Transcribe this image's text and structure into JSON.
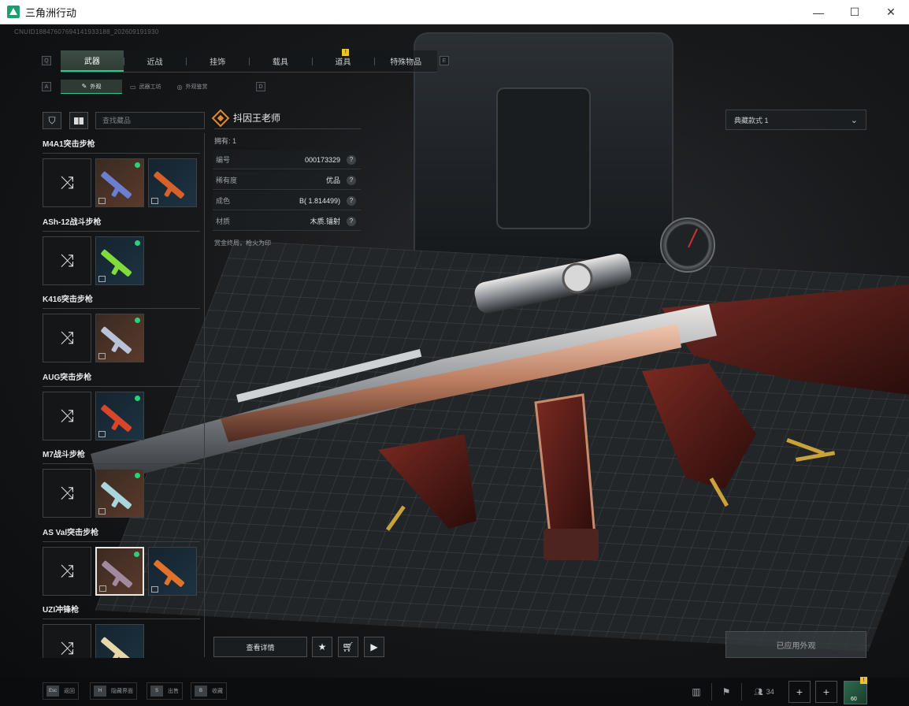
{
  "window": {
    "title": "三角洲行动",
    "controls": {
      "minimize": "—",
      "maximize": "☐",
      "close": "✕"
    }
  },
  "uid_text": "CNUID18847607694141933188_202609191930",
  "nav": {
    "left_key": "Q",
    "right_key": "E",
    "tabs": [
      {
        "label": "武器",
        "active": true
      },
      {
        "label": "近战",
        "active": false
      },
      {
        "label": "挂饰",
        "active": false
      },
      {
        "label": "载具",
        "active": false
      },
      {
        "label": "道具",
        "active": false,
        "badge": "!"
      },
      {
        "label": "特殊物品",
        "active": false
      }
    ],
    "sub_left_key": "A",
    "sub_right_key": "D",
    "subtabs": [
      {
        "label": "外观",
        "icon": "brush-icon",
        "active": true
      },
      {
        "label": "武器工坊",
        "icon": "workshop-icon",
        "active": false
      },
      {
        "label": "外观鉴赏",
        "icon": "appreciate-icon",
        "active": false
      }
    ]
  },
  "left_panel": {
    "search_placeholder": "查找藏品",
    "filter_icon": "filter-icon",
    "view_icon": "grid-view-icon",
    "groups": [
      {
        "title": "M4A1突击步枪",
        "skins": [
          {
            "type": "random"
          },
          {
            "type": "thumb",
            "owned_dot": true,
            "color": "#6a7fd0"
          },
          {
            "type": "thumb",
            "owned_dot": false,
            "color": "#d8612a",
            "tone": "blue"
          }
        ]
      },
      {
        "title": "ASh-12战斗步枪",
        "skins": [
          {
            "type": "random"
          },
          {
            "type": "thumb",
            "owned_dot": true,
            "color": "#7fdc3a",
            "tone": "blue"
          }
        ]
      },
      {
        "title": "K416突击步枪",
        "skins": [
          {
            "type": "random"
          },
          {
            "type": "thumb",
            "owned_dot": true,
            "color": "#b9c3d8"
          }
        ]
      },
      {
        "title": "AUG突击步枪",
        "skins": [
          {
            "type": "random"
          },
          {
            "type": "thumb",
            "owned_dot": true,
            "color": "#d8452a",
            "tone": "blue"
          }
        ]
      },
      {
        "title": "M7战斗步枪",
        "skins": [
          {
            "type": "random"
          },
          {
            "type": "thumb",
            "owned_dot": true,
            "color": "#a9d6dc"
          }
        ]
      },
      {
        "title": "AS Val突击步枪",
        "skins": [
          {
            "type": "random"
          },
          {
            "type": "thumb",
            "owned_dot": true,
            "color": "#a18aa0",
            "selected": true
          },
          {
            "type": "thumb",
            "owned_dot": false,
            "color": "#e0722a",
            "tone": "blue"
          }
        ]
      },
      {
        "title": "UZI冲锋枪",
        "skins": [
          {
            "type": "random"
          },
          {
            "type": "thumb",
            "owned_dot": false,
            "color": "#e6d6a8",
            "tone": "blue"
          }
        ]
      }
    ]
  },
  "info": {
    "skin_name": "抖因王老师",
    "owned": "拥有: 1",
    "attributes": [
      {
        "key": "编号",
        "value": "000173329"
      },
      {
        "key": "稀有度",
        "value": "优品"
      },
      {
        "key": "成色",
        "value": "B( 1.814499)"
      },
      {
        "key": "材质",
        "value": "木质.镭射"
      }
    ],
    "help_glyph": "?",
    "description": "赏金终局，枪火为印"
  },
  "preset": {
    "selected": "典藏款式 1"
  },
  "actions": {
    "details": "查看详情",
    "favorite_icon": "star-icon",
    "cart_icon": "cart-icon",
    "play_icon": "play-icon",
    "apply": "已应用外观"
  },
  "bottom": {
    "hints": [
      {
        "key": "Esc",
        "label": "返回"
      },
      {
        "key": "H",
        "label": "隐藏界面"
      },
      {
        "key": "S",
        "label": "出售"
      },
      {
        "key": "B",
        "label": "收藏"
      }
    ],
    "friends_count": "34",
    "avatar_level": "60",
    "avatar_badge": "!"
  },
  "colors": {
    "accent": "#2fc58a",
    "badge": "#f3c229",
    "rarity_orange": "#e08a2a"
  }
}
